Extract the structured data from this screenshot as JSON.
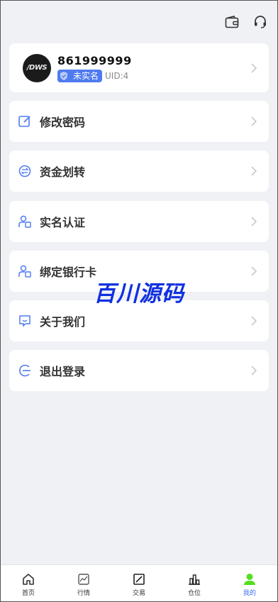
{
  "header": {
    "icons": [
      "wallet-icon",
      "headset-icon"
    ]
  },
  "profile": {
    "avatar_text": "/DWS",
    "username": "861999999",
    "verify_badge": "未实名",
    "uid": "UID:4"
  },
  "menu": [
    {
      "label": "修改密码",
      "icon": "edit-icon"
    },
    {
      "label": "资金划转",
      "icon": "transfer-icon"
    },
    {
      "label": "实名认证",
      "icon": "id-verify-icon"
    },
    {
      "label": "绑定银行卡",
      "icon": "bank-card-icon"
    },
    {
      "label": "关于我们",
      "icon": "chat-smile-icon"
    },
    {
      "label": "退出登录",
      "icon": "logout-icon"
    }
  ],
  "watermark": "百川源码",
  "tabbar": [
    {
      "label": "首页",
      "icon": "home-icon"
    },
    {
      "label": "行情",
      "icon": "market-icon"
    },
    {
      "label": "交易",
      "icon": "trade-icon"
    },
    {
      "label": "仓位",
      "icon": "position-icon"
    },
    {
      "label": "我的",
      "icon": "user-icon",
      "active": true
    }
  ],
  "colors": {
    "accent": "#3a6ff0",
    "badge": "#4f7bf0",
    "active_tab_icon": "#55dd22",
    "background": "#f0f1f5",
    "watermark": "#1030e0"
  }
}
